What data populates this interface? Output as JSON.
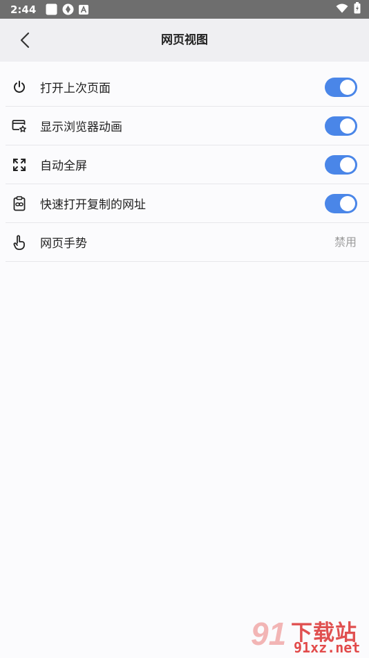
{
  "status_bar": {
    "time": "2:44"
  },
  "header": {
    "title": "网页视图"
  },
  "settings": [
    {
      "label": "打开上次页面",
      "icon": "power-icon",
      "control": "toggle",
      "enabled": true
    },
    {
      "label": "显示浏览器动画",
      "icon": "browser-star-icon",
      "control": "toggle",
      "enabled": true
    },
    {
      "label": "自动全屏",
      "icon": "fullscreen-icon",
      "control": "toggle",
      "enabled": true
    },
    {
      "label": "快速打开复制的网址",
      "icon": "clipboard-link-icon",
      "control": "toggle",
      "enabled": true
    },
    {
      "label": "网页手势",
      "icon": "hand-gesture-icon",
      "control": "value",
      "value": "禁用"
    }
  ],
  "watermark": {
    "number": "91",
    "brand": "下载站",
    "url": "91xz.net"
  },
  "colors": {
    "accent": "#4a86e8",
    "status_bar": "#6e6e6e",
    "header_bg": "#efeff2"
  }
}
